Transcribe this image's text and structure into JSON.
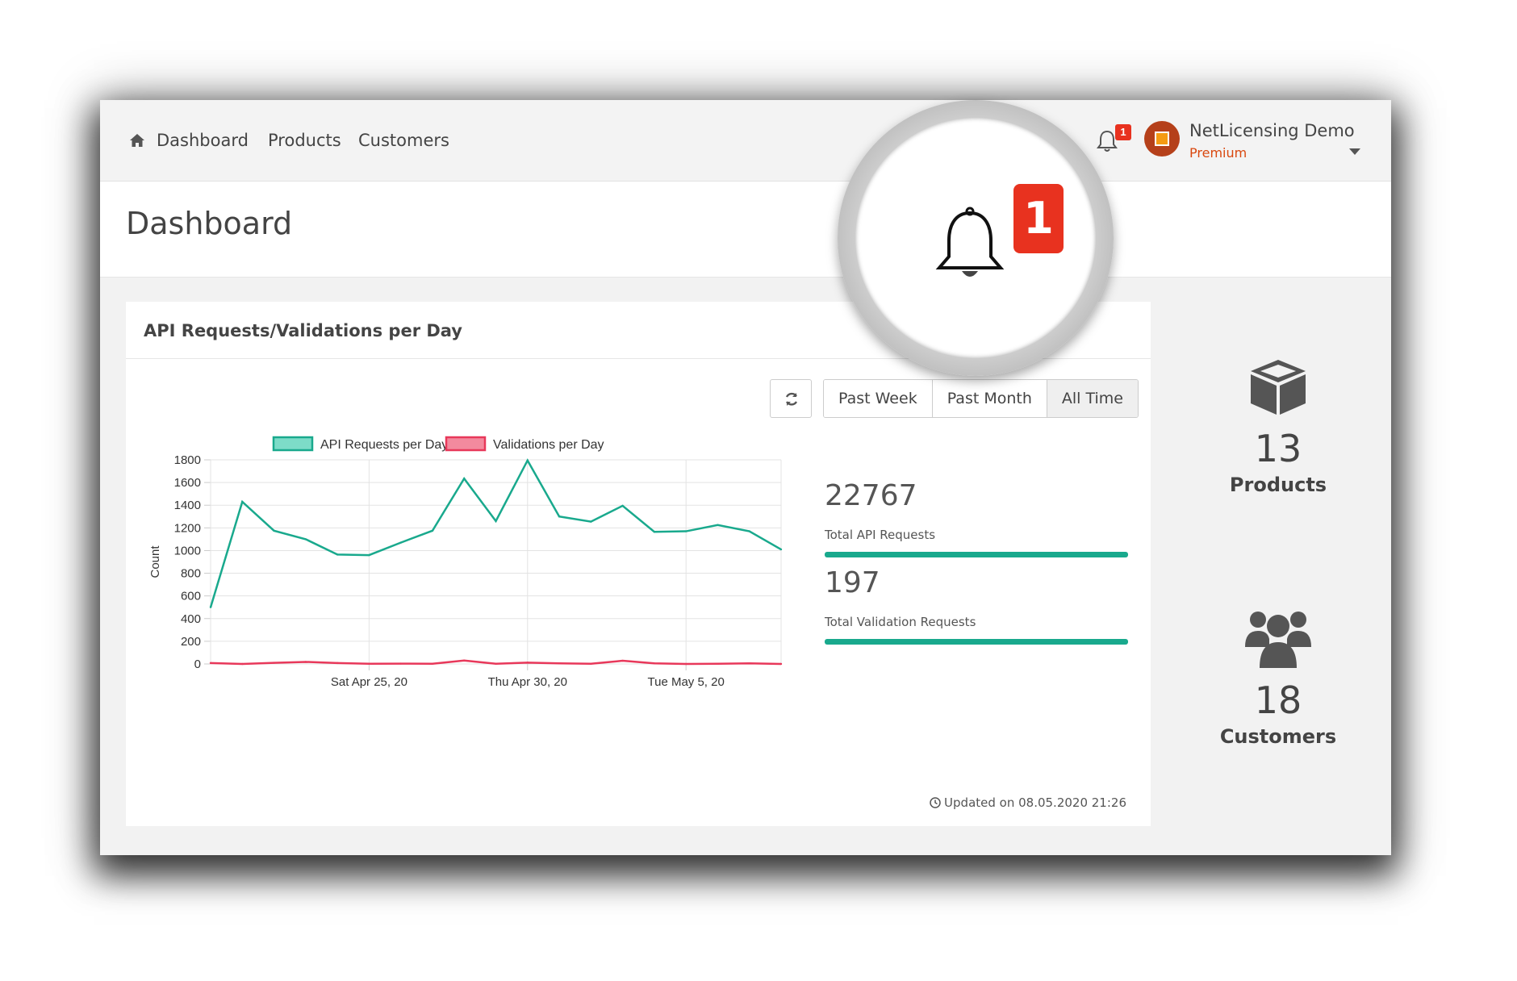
{
  "nav": {
    "items": [
      {
        "label": "Dashboard",
        "icon": "home-icon"
      },
      {
        "label": "Products"
      },
      {
        "label": "Customers"
      }
    ],
    "notifications": {
      "count": "1"
    },
    "user": {
      "name": "NetLicensing Demo",
      "plan": "Premium"
    }
  },
  "page": {
    "title": "Dashboard"
  },
  "panel": {
    "title": "API Requests/Validations per Day",
    "ranges": [
      "Past Week",
      "Past Month",
      "All Time"
    ],
    "active_range": "All Time",
    "stats": [
      {
        "value": "22767",
        "label": "Total API Requests",
        "progress": 1.0
      },
      {
        "value": "197",
        "label": "Total Validation Requests",
        "progress": 1.0
      }
    ],
    "updated": "Updated on 08.05.2020 21:26"
  },
  "widgets": [
    {
      "count": "13",
      "label": "Products",
      "icon": "box-icon"
    },
    {
      "count": "18",
      "label": "Customers",
      "icon": "users-icon"
    }
  ],
  "magnifier": {
    "badge": "1"
  },
  "colors": {
    "api": "#19a98d",
    "validation": "#e8385a",
    "badge": "#e8321f",
    "plan": "#d9480f"
  },
  "chart_data": {
    "type": "line",
    "ylabel": "Count",
    "ylim": [
      0,
      1800
    ],
    "yticks": [
      0,
      200,
      400,
      600,
      800,
      1000,
      1200,
      1400,
      1600,
      1800
    ],
    "xtick_labels": [
      "Sat Apr 25, 20",
      "Thu Apr 30, 20",
      "Tue May 5, 20"
    ],
    "x": [
      "2020-04-20",
      "2020-04-21",
      "2020-04-22",
      "2020-04-23",
      "2020-04-24",
      "2020-04-25",
      "2020-04-26",
      "2020-04-27",
      "2020-04-28",
      "2020-04-29",
      "2020-04-30",
      "2020-05-01",
      "2020-05-02",
      "2020-05-03",
      "2020-05-04",
      "2020-05-05",
      "2020-05-06",
      "2020-05-07",
      "2020-05-08"
    ],
    "series": [
      {
        "name": "API Requests per Day",
        "color": "#19a98d",
        "values": [
          500,
          1430,
          1175,
          1100,
          965,
          960,
          1070,
          1175,
          1635,
          1260,
          1795,
          1300,
          1255,
          1395,
          1165,
          1170,
          1225,
          1170,
          1010
        ]
      },
      {
        "name": "Validations per Day",
        "color": "#e8385a",
        "values": [
          8,
          0,
          10,
          18,
          8,
          2,
          3,
          2,
          30,
          2,
          12,
          5,
          2,
          28,
          5,
          0,
          2,
          5,
          0
        ]
      }
    ]
  }
}
